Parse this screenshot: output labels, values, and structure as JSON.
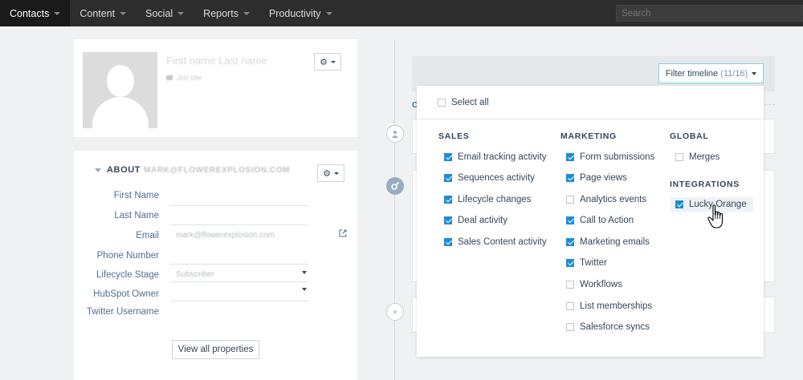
{
  "topnav": {
    "items": [
      {
        "label": "Contacts",
        "active": true
      },
      {
        "label": "Content",
        "active": false
      },
      {
        "label": "Social",
        "active": false
      },
      {
        "label": "Reports",
        "active": false
      },
      {
        "label": "Productivity",
        "active": false
      }
    ],
    "search_placeholder": "Search"
  },
  "profile": {
    "name": "First name Last name",
    "job_title": "Job title",
    "gear_icon": "gear-icon"
  },
  "about": {
    "title": "ABOUT",
    "email_blurred": "MARK@FLOWEREXPLOSION.COM",
    "properties": [
      {
        "label": "First Name",
        "value": ""
      },
      {
        "label": "Last Name",
        "value": ""
      },
      {
        "label": "Email",
        "value": "mark@flowerexplosion.com"
      },
      {
        "label": "Phone Number",
        "value": ""
      },
      {
        "label": "Lifecycle Stage",
        "value": "Subscriber"
      },
      {
        "label": "HubSpot Owner",
        "value": ""
      },
      {
        "label": "Twitter Username",
        "value": ""
      }
    ],
    "view_all": "View all properties"
  },
  "timeline": {
    "filter_label": "Filter timeline",
    "filter_count": "(11/16)",
    "letter": "C"
  },
  "filter_panel": {
    "select_all": "Select all",
    "sales": {
      "heading": "SALES",
      "items": [
        {
          "label": "Email tracking activity",
          "checked": true
        },
        {
          "label": "Sequences activity",
          "checked": true
        },
        {
          "label": "Lifecycle changes",
          "checked": true
        },
        {
          "label": "Deal activity",
          "checked": true
        },
        {
          "label": "Sales Content activity",
          "checked": true
        }
      ]
    },
    "marketing": {
      "heading": "MARKETING",
      "items": [
        {
          "label": "Form submissions",
          "checked": true
        },
        {
          "label": "Page views",
          "checked": true
        },
        {
          "label": "Analytics events",
          "checked": false
        },
        {
          "label": "Call to Action",
          "checked": true
        },
        {
          "label": "Marketing emails",
          "checked": true
        },
        {
          "label": "Twitter",
          "checked": true
        },
        {
          "label": "Workflows",
          "checked": false
        },
        {
          "label": "List memberships",
          "checked": false
        },
        {
          "label": "Salesforce syncs",
          "checked": false
        }
      ]
    },
    "global": {
      "heading": "GLOBAL",
      "items": [
        {
          "label": "Merges",
          "checked": false
        }
      ]
    },
    "integrations": {
      "heading": "INTEGRATIONS",
      "items": [
        {
          "label": "Lucky Orange",
          "checked": true
        }
      ]
    }
  },
  "colors": {
    "accent": "#1e8cd6",
    "nav_bg": "#2d2d2d",
    "filter_border": "#7fd1de"
  }
}
